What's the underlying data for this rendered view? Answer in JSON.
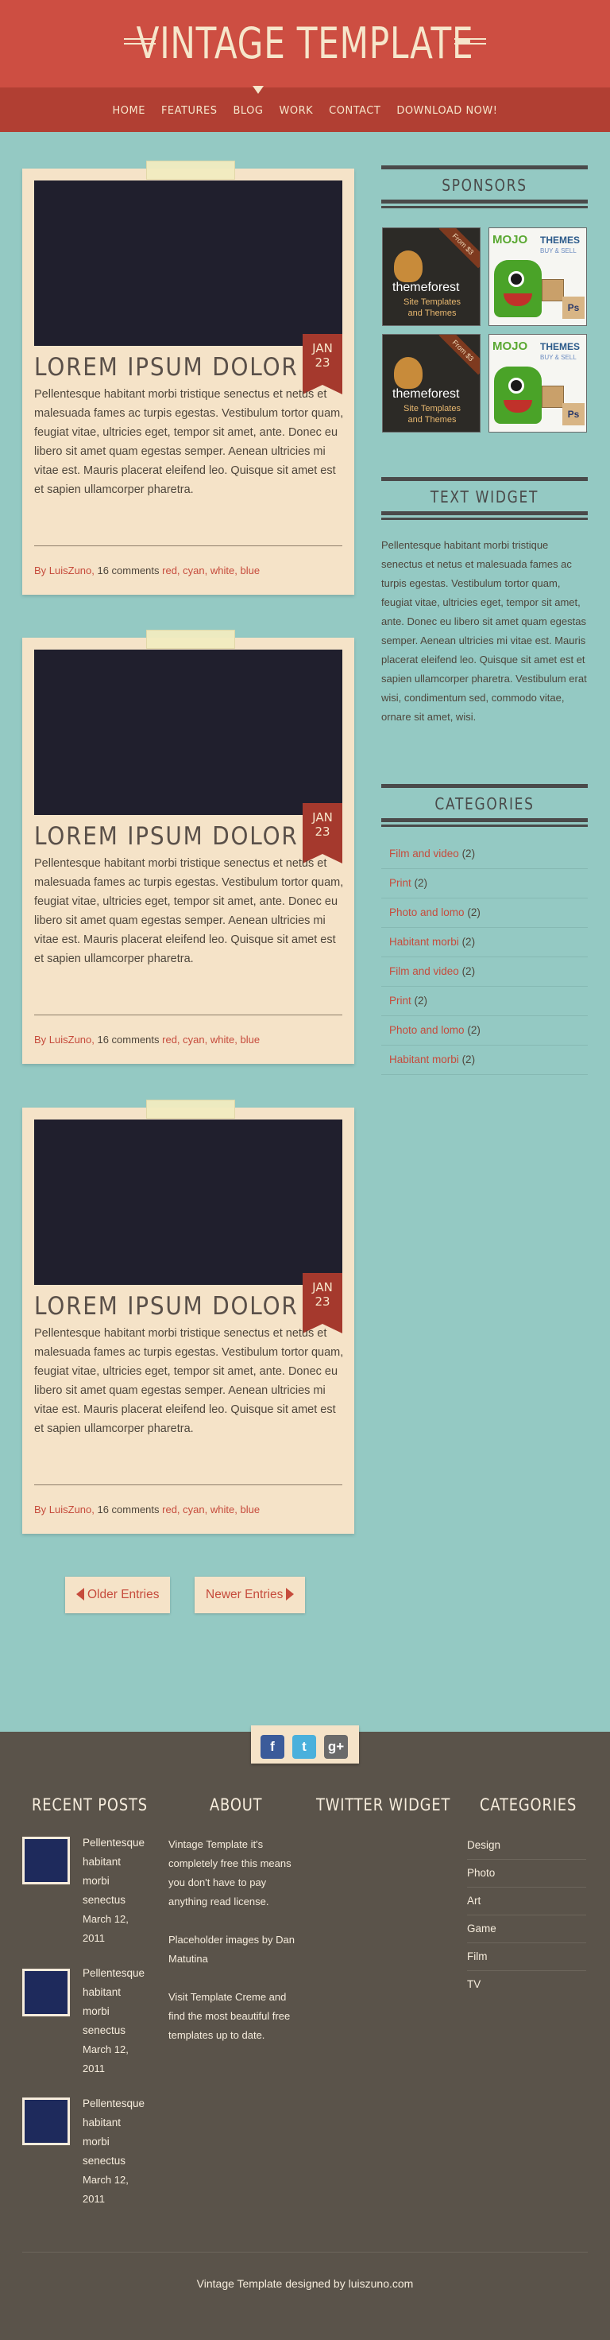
{
  "header": {
    "title": "VINTAGE TEMPLATE",
    "nav": [
      "HOME",
      "FEATURES",
      "BLOG",
      "WORK",
      "CONTACT",
      "DOWNLOAD NOW!"
    ]
  },
  "posts": [
    {
      "month": "JAN",
      "day": "23",
      "title": "LOREM IPSUM DOLOR",
      "body": "Pellentesque habitant morbi tristique senectus et netus et malesuada fames ac turpis egestas. Vestibulum tortor quam, feugiat vitae, ultricies eget, tempor sit amet, ante. Donec eu libero sit amet quam egestas semper. Aenean ultricies mi vitae est. Mauris placerat eleifend leo. Quisque sit amet est et sapien ullamcorper pharetra.",
      "author": "By LuisZuno,",
      "comments": " 16 comments ",
      "tags": [
        "red,",
        "cyan,",
        "white,",
        "blue"
      ]
    },
    {
      "month": "JAN",
      "day": "23",
      "title": "LOREM IPSUM DOLOR",
      "body": "Pellentesque habitant morbi tristique senectus et netus et malesuada fames ac turpis egestas. Vestibulum tortor quam, feugiat vitae, ultricies eget, tempor sit amet, ante. Donec eu libero sit amet quam egestas semper. Aenean ultricies mi vitae est. Mauris placerat eleifend leo. Quisque sit amet est et sapien ullamcorper pharetra.",
      "author": "By LuisZuno,",
      "comments": " 16 comments ",
      "tags": [
        "red,",
        "cyan,",
        "white,",
        "blue"
      ]
    },
    {
      "month": "JAN",
      "day": "23",
      "title": "LOREM IPSUM DOLOR",
      "body": "Pellentesque habitant morbi tristique senectus et netus et malesuada fames ac turpis egestas. Vestibulum tortor quam, feugiat vitae, ultricies eget, tempor sit amet, ante. Donec eu libero sit amet quam egestas semper. Aenean ultricies mi vitae est. Mauris placerat eleifend leo. Quisque sit amet est et sapien ullamcorper pharetra.",
      "author": "By LuisZuno,",
      "comments": " 16 comments ",
      "tags": [
        "red,",
        "cyan,",
        "white,",
        "blue"
      ]
    }
  ],
  "sidebar": {
    "sponsors_heading": "SPONSORS",
    "ads": {
      "themeforest": {
        "ribbon": "From $3",
        "name": "themeforest",
        "sub1": "Site Templates",
        "sub2": "and Themes"
      },
      "mojo": {
        "name": "MOJO",
        "themes": "THEMES",
        "buy": "BUY & SELL",
        "ps": "Ps"
      }
    },
    "text_widget_heading": "TEXT WIDGET",
    "text_widget_body": "Pellentesque habitant morbi tristique senectus et netus et malesuada fames ac turpis egestas. Vestibulum tortor quam, feugiat vitae, ultricies eget, tempor sit amet, ante. Donec eu libero sit amet quam egestas semper. Aenean ultricies mi vitae est. Mauris placerat eleifend leo. Quisque sit amet est et sapien ullamcorper pharetra. Vestibulum erat wisi, condimentum sed, commodo vitae, ornare sit amet, wisi.",
    "categories_heading": "CATEGORIES",
    "categories": [
      {
        "name": "Film and video",
        "count": "(2)"
      },
      {
        "name": "Print",
        "count": "(2)"
      },
      {
        "name": "Photo and lomo",
        "count": "(2)"
      },
      {
        "name": "Habitant morbi",
        "count": "(2)"
      },
      {
        "name": "Film and video",
        "count": "(2)"
      },
      {
        "name": "Print",
        "count": "(2)"
      },
      {
        "name": "Photo and lomo",
        "count": "(2)"
      },
      {
        "name": "Habitant morbi",
        "count": "(2)"
      }
    ]
  },
  "pagination": {
    "older": "Older Entries",
    "newer": "Newer Entries"
  },
  "footer": {
    "social": {
      "facebook": "f",
      "twitter": "t",
      "google": "g+"
    },
    "headings": {
      "recent": "RECENT POSTS",
      "about": "ABOUT",
      "twitter": "TWITTER WIDGET",
      "categories": "CATEGORIES"
    },
    "recent_posts": [
      {
        "l1": "Pellentesque",
        "l2": "habitant",
        "l3": "morbi",
        "l4": "senectus",
        "date": "March 12,",
        "year": "2011"
      },
      {
        "l1": "Pellentesque",
        "l2": "habitant",
        "l3": "morbi",
        "l4": "senectus",
        "date": "March 12,",
        "year": "2011"
      },
      {
        "l1": "Pellentesque",
        "l2": "habitant",
        "l3": "morbi",
        "l4": "senectus",
        "date": "March 12,",
        "year": "2011"
      }
    ],
    "about": {
      "p1": "Vintage Template it's completely free this means you don't have to pay anything read license.",
      "p2": "Placeholder images by Dan Matutina",
      "p3": "Visit Template Creme and find the most beautiful free templates up to date."
    },
    "categories": [
      "Design",
      "Photo",
      "Art",
      "Game",
      "Film",
      "TV"
    ],
    "credit": "Vintage Template designed by luiszuno.com"
  },
  "colors": {
    "background": "#94c9c3",
    "header_red": "#cd4e42",
    "nav_red": "#b13f33",
    "accent": "#c64b3c",
    "paper": "#f5e3c8",
    "footer": "#5a534a"
  }
}
